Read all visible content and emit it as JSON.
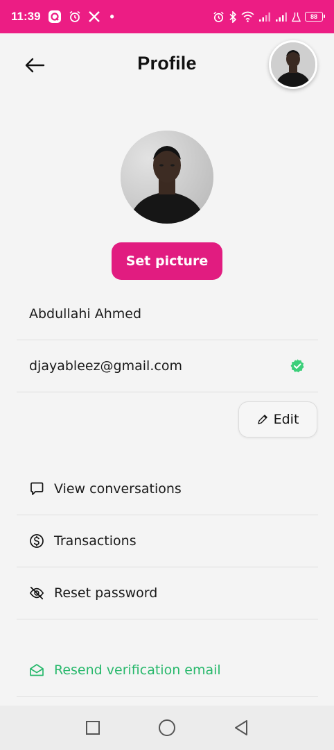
{
  "status_bar": {
    "time": "11:39",
    "battery": "88",
    "notification_dot": "•"
  },
  "header": {
    "title": "Profile"
  },
  "profile": {
    "set_picture_label": "Set picture",
    "name": "Abdullahi Ahmed",
    "email": "djayableez@gmail.com",
    "email_verified": true,
    "edit_label": "Edit"
  },
  "menu": {
    "items": [
      {
        "label": "View conversations",
        "icon": "chat-bubble-icon"
      },
      {
        "label": "Transactions",
        "icon": "dollar-circle-icon"
      },
      {
        "label": "Reset password",
        "icon": "eye-off-icon"
      },
      {
        "label": "Resend verification email",
        "icon": "envelope-open-icon"
      }
    ]
  },
  "colors": {
    "brand": "#ec1d84",
    "button": "#e11c80",
    "success": "#27b86b",
    "background": "#f4f4f4"
  }
}
